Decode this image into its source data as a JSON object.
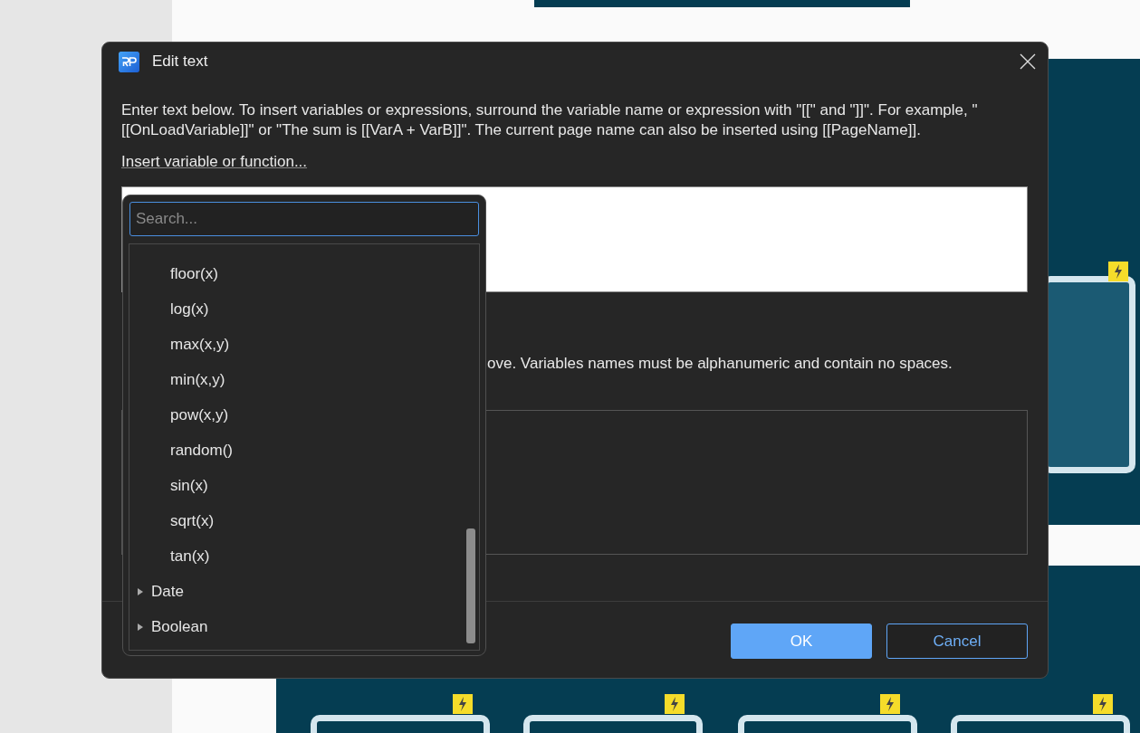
{
  "dialog": {
    "title": "Edit text",
    "description": "Enter text below. To insert variables or expressions, surround the variable name or expression with \"[[\" and \"]]\". For example, \"[[OnLoadVariable]]\" or \"The sum is [[VarA + VarB]]\". The current page name can also be inserted using [[PageName]].",
    "insert_link": "Insert variable or function...",
    "variables_hint": "ove. Variables names must be alphanumeric and contain no spaces.",
    "buttons": [
      {
        "label": "OK",
        "kind": "primary"
      },
      {
        "label": "Cancel",
        "kind": "secondary"
      }
    ]
  },
  "dropdown": {
    "search": {
      "placeholder": "Search..."
    },
    "items": [
      {
        "label": "floor(x)",
        "kind": "function"
      },
      {
        "label": "log(x)",
        "kind": "function"
      },
      {
        "label": "max(x,y)",
        "kind": "function"
      },
      {
        "label": "min(x,y)",
        "kind": "function"
      },
      {
        "label": "pow(x,y)",
        "kind": "function"
      },
      {
        "label": "random()",
        "kind": "function"
      },
      {
        "label": "sin(x)",
        "kind": "function"
      },
      {
        "label": "sqrt(x)",
        "kind": "function"
      },
      {
        "label": "tan(x)",
        "kind": "function"
      },
      {
        "label": "Date",
        "kind": "category",
        "expanded": false
      },
      {
        "label": "Boolean",
        "kind": "category",
        "expanded": false
      }
    ]
  }
}
